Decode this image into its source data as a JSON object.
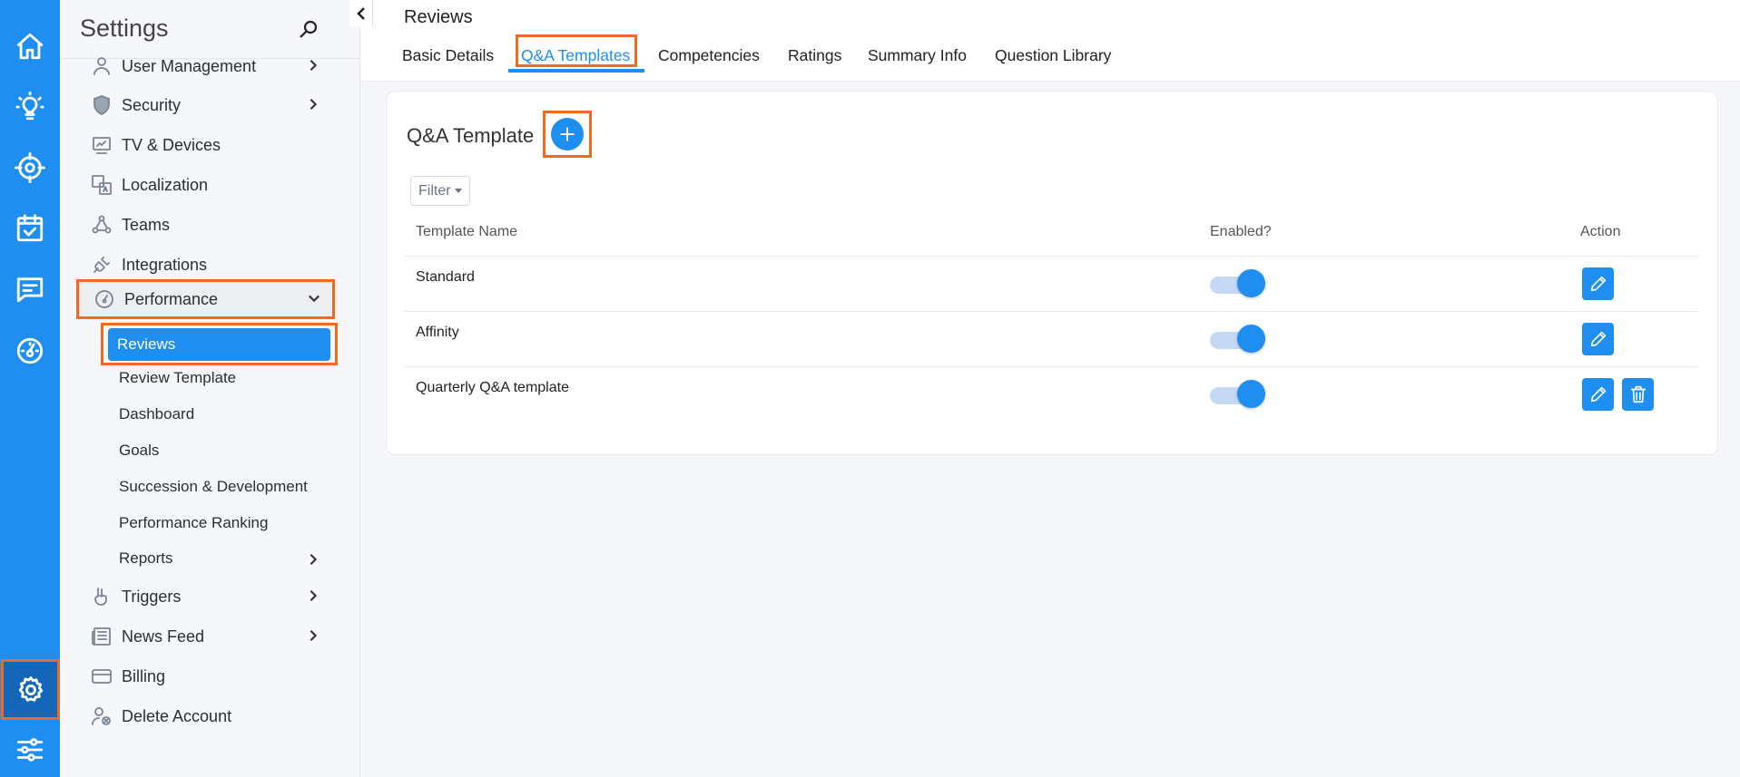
{
  "rail": {
    "items": [
      {
        "name": "home-icon"
      },
      {
        "name": "lightbulb-icon"
      },
      {
        "name": "target-icon"
      },
      {
        "name": "calendar-check-icon"
      },
      {
        "name": "chat-icon"
      },
      {
        "name": "gauge-icon"
      },
      {
        "name": "gear-icon",
        "active": true
      },
      {
        "name": "sliders-icon"
      }
    ]
  },
  "sidebar": {
    "title": "Settings",
    "items": [
      {
        "label": "User Management",
        "icon": "user-icon",
        "has_chevron": true
      },
      {
        "label": "Security",
        "icon": "shield-icon",
        "has_chevron": true
      },
      {
        "label": "TV & Devices",
        "icon": "monitor-icon",
        "has_chevron": false
      },
      {
        "label": "Localization",
        "icon": "translate-icon",
        "has_chevron": false
      },
      {
        "label": "Teams",
        "icon": "teams-icon",
        "has_chevron": false
      },
      {
        "label": "Integrations",
        "icon": "plug-icon",
        "has_chevron": false
      },
      {
        "label": "Performance",
        "icon": "gauge-icon",
        "has_chevron": true,
        "expanded": true
      },
      {
        "label": "Triggers",
        "icon": "peace-hand-icon",
        "has_chevron": true
      },
      {
        "label": "News Feed",
        "icon": "newspaper-icon",
        "has_chevron": true
      },
      {
        "label": "Billing",
        "icon": "credit-card-icon",
        "has_chevron": false
      },
      {
        "label": "Delete Account",
        "icon": "user-remove-icon",
        "has_chevron": false
      }
    ],
    "performance_sub": {
      "active": "Reviews",
      "items": [
        "Review Template",
        "Dashboard",
        "Goals",
        "Succession & Development",
        "Performance Ranking",
        "Reports"
      ]
    }
  },
  "header": {
    "title": "Reviews",
    "tabs": [
      "Basic Details",
      "Q&A Templates",
      "Competencies",
      "Ratings",
      "Summary Info",
      "Question Library"
    ],
    "active_tab": "Q&A Templates"
  },
  "card": {
    "title": "Q&A Template",
    "filter_label": "Filter",
    "columns": [
      "Template Name",
      "Enabled?",
      "Action"
    ],
    "rows": [
      {
        "name": "Standard",
        "enabled": true,
        "deletable": false
      },
      {
        "name": "Affinity",
        "enabled": true,
        "deletable": false
      },
      {
        "name": "Quarterly Q&A template",
        "enabled": true,
        "deletable": true
      }
    ]
  },
  "colors": {
    "accent": "#1e8ef0",
    "highlight": "#f26a21",
    "rail": "#1e8ef0"
  }
}
